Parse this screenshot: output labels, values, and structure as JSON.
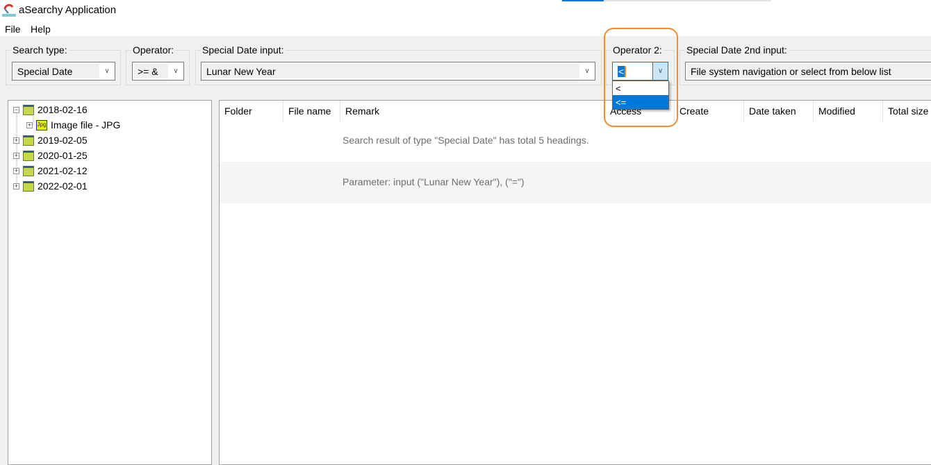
{
  "window": {
    "title": "aSearchy Application",
    "progress_percent": 20,
    "accent_color": "#0078d7"
  },
  "menu": [
    "File",
    "Help"
  ],
  "toolbar": {
    "search_type": {
      "label": "Search type:",
      "value": "Special Date"
    },
    "operator": {
      "label": "Operator:",
      "value": ">= &"
    },
    "special_date_input": {
      "label": "Special Date input:",
      "value": "Lunar New Year"
    },
    "operator2": {
      "label": "Operator 2:",
      "value": "<",
      "options": [
        "<",
        "<="
      ],
      "selected_option": "<="
    },
    "special_date_2nd_input": {
      "label": "Special Date 2nd input:",
      "value": "File system navigation or select from below list"
    }
  },
  "tree": [
    {
      "label": "2018-02-16",
      "expanded": true,
      "children": [
        {
          "label": "Image file - JPG",
          "icon": "Jpg"
        }
      ]
    },
    {
      "label": "2019-02-05"
    },
    {
      "label": "2020-01-25"
    },
    {
      "label": "2021-02-12"
    },
    {
      "label": "2022-02-01"
    }
  ],
  "columns": [
    "Folder",
    "File name",
    "Remark",
    "Access",
    "Create",
    "Date taken",
    "Modified",
    "Total size"
  ],
  "rows": [
    "Search result of type \"Special Date\" has total 5 headings.",
    "Parameter: input (\"Lunar New Year\"), (\"=\")"
  ],
  "highlight_color": "#f58a2e"
}
